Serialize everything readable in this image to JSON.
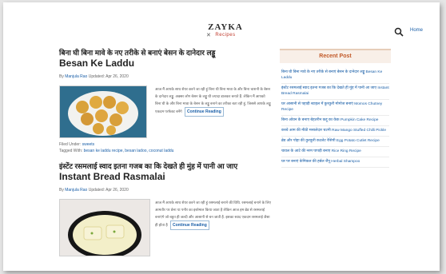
{
  "header": {
    "logo_top": "ZAYKA",
    "logo_bottom": "Recipes",
    "home_label": "Home"
  },
  "posts": [
    {
      "title_hindi": "बिना घी बिना मावे के नए तरीके से बनाएं बेसन के दानेदार लड्डू",
      "title_english": "Besan Ke Laddu",
      "meta_prefix": "By",
      "author": "Manjula Rao",
      "updated": "Updated: Apr 26, 2020",
      "excerpt": "आज मैं आपके साथ शेयर करने जा रही हूं बिना घी बिना मावा के और बिना चाशनी के बेसन के दानेदार लड्डू. अक्सर लोग बेसन के लड्डू घी ज्यादा डालकर बनाते हैं. लेकिन मैं आपको बिना घी के और बिना मावा के बेसन के लड्डू बनाने का तरीका बता रही हूं, जिससे आपके लड्डू एकदम परफेक्ट बनेंगे",
      "continue_label": "Continue Reading",
      "filed_label": "Filed Under:",
      "filed_value": "sweets",
      "tagged_label": "Tagged With:",
      "tags": "besan ke laddu recipe, besan ladoo, coconut laddu"
    },
    {
      "title_hindi": "इंस्टेंट रसमलाई स्वाद इतना गजब का कि देखते ही मुंह में पानी आ जाए",
      "title_english": "Instant Bread Rasmalai",
      "meta_prefix": "By",
      "author": "Manjula Rao",
      "updated": "Updated: Apr 26, 2020",
      "excerpt": "आज मैं आपके साथ शेयर करने जा रही हूं रसमलाई बनाने की विधि. रसमलाई बनाने के लिए आमतौर पर छेना या पनीर का इस्तेमाल किया जाता है लेकिन आज हम ब्रेड से रसमलाई बनाएंगे जो बहुत ही जल्दी और आसानी से बन जाती है. इसका स्वाद एकदम रसमलाई जैसा ही होता है",
      "continue_label": "Continue Reading"
    }
  ],
  "sidebar": {
    "title": "Recent Post",
    "items": [
      "बिना घी बिना मावे के नए तरीके से बनाएं बेसन के दानेदार लड्डू Besan Ke Laddu",
      "इंस्टेंट रसमलाई स्वाद इतना गजब का कि देखते ही मुंह में पानी आ जाए Instant Bread Rasmalai",
      "घर आसानी से पहाड़ी स्टाइल में कुरकुरी मोमोज बनाएं Momos Chutney Recipe",
      "बिना ओवन के बनाए बेहतरीन कद्दू का केक Pumpkin Cake Recipe",
      "कच्चे आम की मीठी मसालेदार चटनी Raw Mango Stuffed Chilli Pickle",
      "ब्रेड और पोहा की कुरकुरी कटलेट रेसिपी Egg Potato Cutlet Recipe",
      "चावल के आटे की नरम पापड़ी बनाए Rice Ring Recipe",
      "घर पर बनाएं केमिकल फ्री हर्बल शैंपू Herbal Shampoo"
    ]
  },
  "colors": {
    "link": "#1a5fa8",
    "widget_title": "#c25a2a",
    "widget_bg": "#f8efe8"
  }
}
